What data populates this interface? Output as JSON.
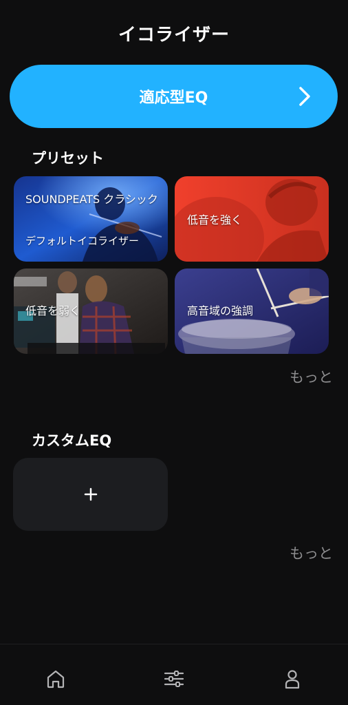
{
  "header": {
    "title": "イコライザー"
  },
  "adaptive_eq": {
    "label": "適応型EQ",
    "icon": "chevron-right-icon"
  },
  "presets": {
    "section_title": "プリセット",
    "items": [
      {
        "title": "SOUNDPEATS クラシック",
        "subtitle": "デフォルトイコライザー",
        "color": "#1d4fb5"
      },
      {
        "title": "低音を強く",
        "color": "#e8392a"
      },
      {
        "title": "低音を弱く",
        "color": "#3a2f2a"
      },
      {
        "title": "高音域の強調",
        "color": "#2d2f7a"
      }
    ],
    "more_label": "もっと"
  },
  "custom_eq": {
    "section_title": "カスタムEQ",
    "add_icon": "plus-icon",
    "more_label": "もっと"
  },
  "nav": {
    "items": [
      {
        "icon": "home-icon"
      },
      {
        "icon": "equalizer-icon"
      },
      {
        "icon": "profile-icon"
      }
    ]
  },
  "colors": {
    "background": "#0e0e0f",
    "accent": "#22b2ff",
    "card_bg": "#1c1d20",
    "muted_text": "#8d8d8f"
  }
}
